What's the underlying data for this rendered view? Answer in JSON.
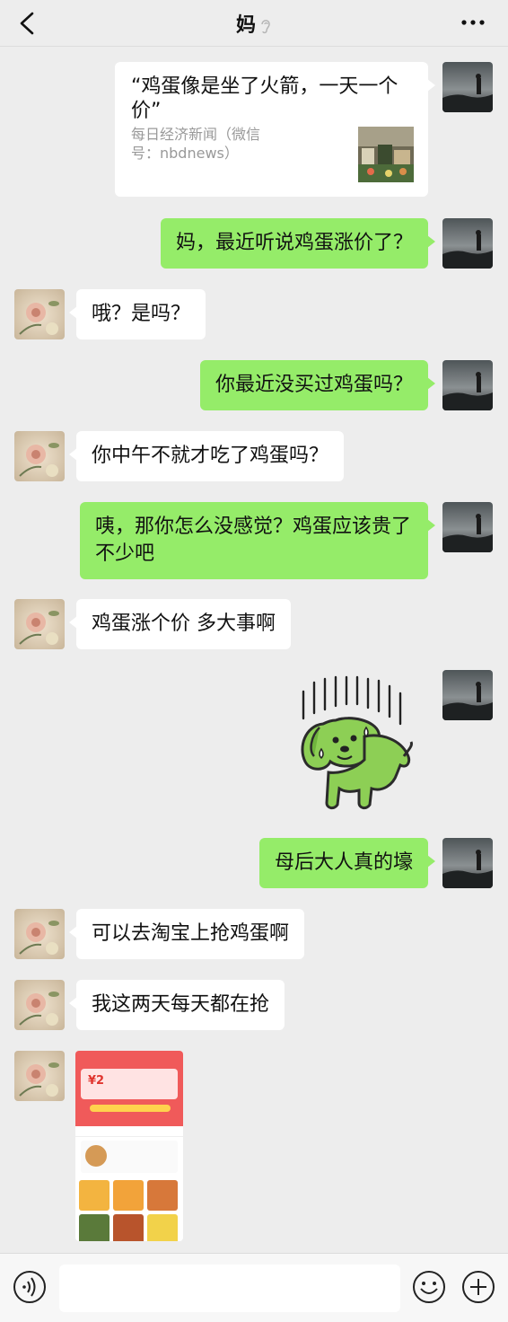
{
  "header": {
    "title": "妈",
    "back_icon": "chevron-left-icon",
    "muted_icon": "ear-icon",
    "more_icon": "ellipsis-icon"
  },
  "messages": [
    {
      "type": "link_card",
      "side": "right",
      "title": "“鸡蛋像是坐了火箭，一天一个价”",
      "source": "每日经济新闻（微信号：nbdnews）"
    },
    {
      "type": "text",
      "side": "right",
      "text": "妈，最近听说鸡蛋涨价了？"
    },
    {
      "type": "text",
      "side": "left",
      "text": "哦？是吗？"
    },
    {
      "type": "text",
      "side": "right",
      "text": "你最近没买过鸡蛋吗？"
    },
    {
      "type": "text",
      "side": "left",
      "text": "你中午不就才吃了鸡蛋吗？"
    },
    {
      "type": "text",
      "side": "right",
      "text": "咦，那你怎么没感觉？鸡蛋应该贵了不少吧"
    },
    {
      "type": "text",
      "side": "left",
      "text": "鸡蛋涨个价 多大事啊"
    },
    {
      "type": "sticker",
      "side": "right",
      "sticker": "sweating-green-dog"
    },
    {
      "type": "text",
      "side": "right",
      "text": "母后大人真的壕"
    },
    {
      "type": "text",
      "side": "left",
      "text": "可以去淘宝上抢鸡蛋啊"
    },
    {
      "type": "text",
      "side": "left",
      "text": "我这两天每天都在抢"
    },
    {
      "type": "image",
      "side": "left",
      "image": "taobao-screenshot",
      "coupon_text": "¥2"
    }
  ],
  "input_bar": {
    "voice_icon": "voice-icon",
    "emoji_icon": "emoji-icon",
    "plus_icon": "plus-icon"
  },
  "colors": {
    "sent_bubble": "#95ec69",
    "received_bubble": "#ffffff",
    "background": "#ededed"
  }
}
